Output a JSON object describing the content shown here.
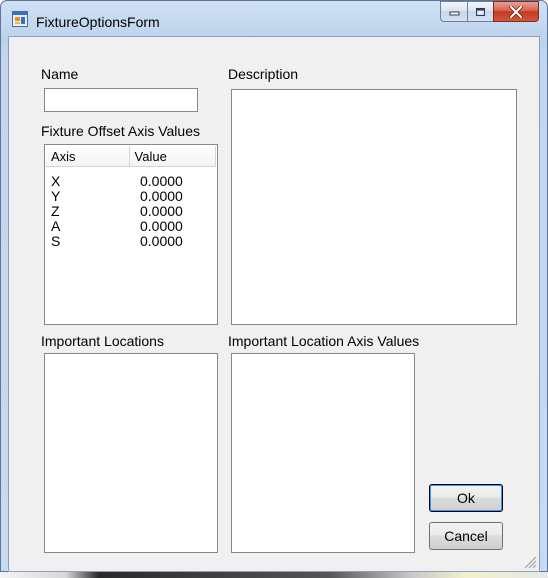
{
  "window": {
    "title": "FixtureOptionsForm",
    "icon": "form-app-icon",
    "controls": [
      "minimize-icon",
      "maximize-icon",
      "close-icon"
    ]
  },
  "form": {
    "name_label": "Name",
    "name_value": "",
    "description_label": "Description",
    "description_value": "",
    "fixture_offset_label": "Fixture Offset Axis Values",
    "axis_list": {
      "columns": [
        "Axis",
        "Value"
      ],
      "rows": [
        {
          "axis": "X",
          "value": "0.0000"
        },
        {
          "axis": "Y",
          "value": "0.0000"
        },
        {
          "axis": "Z",
          "value": "0.0000"
        },
        {
          "axis": "A",
          "value": "0.0000"
        },
        {
          "axis": "S",
          "value": "0.0000"
        }
      ]
    },
    "important_locations_label": "Important Locations",
    "important_location_axis_label": "Important Location Axis Values",
    "ok_label": "Ok",
    "cancel_label": "Cancel"
  }
}
